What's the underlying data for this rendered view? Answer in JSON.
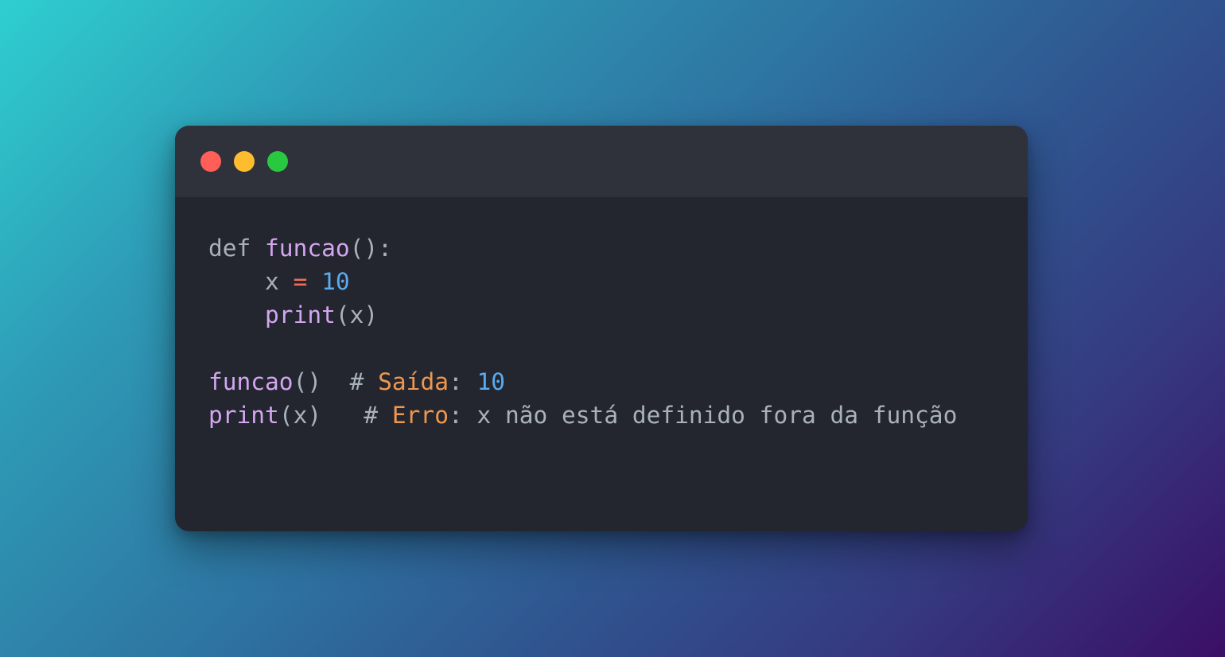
{
  "window": {
    "controls": [
      {
        "name": "close",
        "color": "#ff5f57"
      },
      {
        "name": "minimize",
        "color": "#febc2e"
      },
      {
        "name": "maximize",
        "color": "#28c840"
      }
    ]
  },
  "colors": {
    "plain": "#a9b1bd",
    "function": "#d3a6f0",
    "operator": "#ef6f5a",
    "number": "#5aaaf0",
    "comment_word": "#ef9750",
    "background_code": "#23262e",
    "background_titlebar": "#2f323b"
  },
  "code": {
    "lines": [
      [
        {
          "text": "def ",
          "type": "plain"
        },
        {
          "text": "funcao",
          "type": "function"
        },
        {
          "text": "():",
          "type": "plain"
        }
      ],
      [
        {
          "text": "    x ",
          "type": "plain"
        },
        {
          "text": "=",
          "type": "operator"
        },
        {
          "text": " ",
          "type": "plain"
        },
        {
          "text": "10",
          "type": "number"
        }
      ],
      [
        {
          "text": "    ",
          "type": "plain"
        },
        {
          "text": "print",
          "type": "function"
        },
        {
          "text": "(x)",
          "type": "plain"
        }
      ],
      [],
      [
        {
          "text": "funcao",
          "type": "function"
        },
        {
          "text": "()  # ",
          "type": "plain"
        },
        {
          "text": "Saída",
          "type": "comment_word"
        },
        {
          "text": ": ",
          "type": "plain"
        },
        {
          "text": "10",
          "type": "number"
        }
      ],
      [
        {
          "text": "print",
          "type": "function"
        },
        {
          "text": "(x)   # ",
          "type": "plain"
        },
        {
          "text": "Erro",
          "type": "comment_word"
        },
        {
          "text": ": x não está definido fora da função",
          "type": "plain"
        }
      ]
    ]
  }
}
